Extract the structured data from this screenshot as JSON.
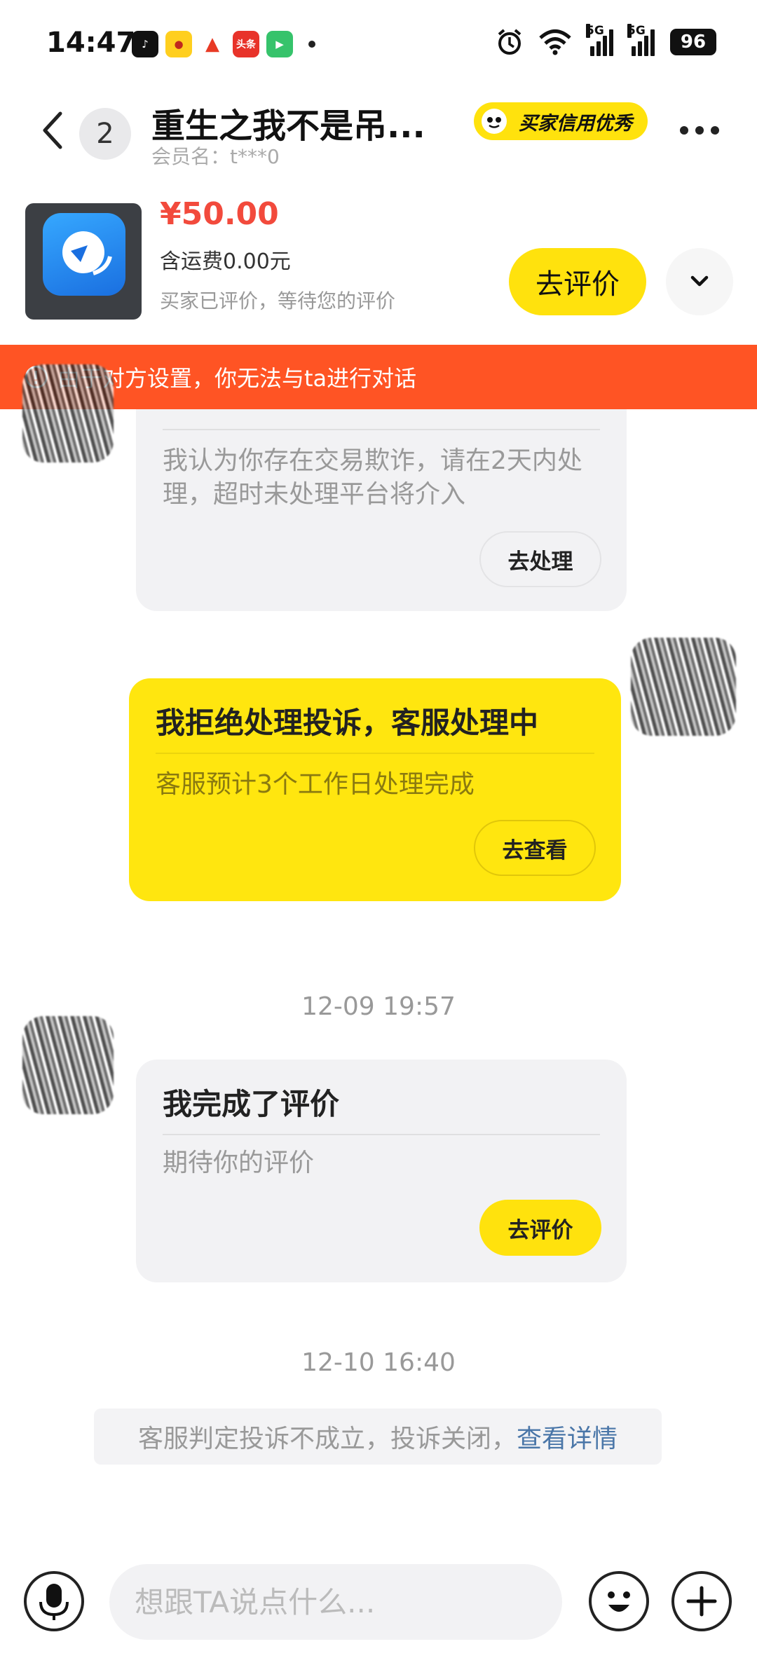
{
  "status_bar": {
    "time": "14:47",
    "notification_icons": [
      "douyin-icon",
      "app-icon",
      "app-icon",
      "toutiao-icon",
      "video-app-icon"
    ],
    "toutiao_label": "头条",
    "network_5g_1": "5G",
    "network_5g_2": "5G",
    "battery": "96"
  },
  "header": {
    "unread_count": "2",
    "title": "重生之我不是吊...",
    "member_name": "会员名：t***0",
    "credit_badge": "买家信用优秀"
  },
  "product": {
    "price": "¥50.00",
    "shipping": "含运费0.00元",
    "review_status": "买家已评价，等待您的评价",
    "evaluate_button": "去评价"
  },
  "banner": {
    "text": "由于对方设置，你无法与ta进行对话"
  },
  "messages": {
    "fraud_notice": {
      "text": "我认为你存在交易欺诈，请在2天内处理，超时未处理平台将介入",
      "button": "去处理"
    },
    "complaint_refusal": {
      "title": "我拒绝处理投诉，客服处理中",
      "text": "客服预计3个工作日处理完成",
      "button": "去查看"
    },
    "timestamp_1": "12-09 19:57",
    "review_done": {
      "title": "我完成了评价",
      "text": "期待你的评价",
      "button": "去评价"
    },
    "timestamp_2": "12-10 16:40",
    "system_notice": {
      "text": "客服判定投诉不成立，投诉关闭，",
      "link": "查看详情"
    }
  },
  "input_bar": {
    "placeholder": "想跟TA说点什么..."
  },
  "colors": {
    "accent_yellow": "#ffe20d",
    "warning_orange": "#ff5424",
    "price_red": "#f24a3c",
    "link_blue": "#4a76a8"
  }
}
